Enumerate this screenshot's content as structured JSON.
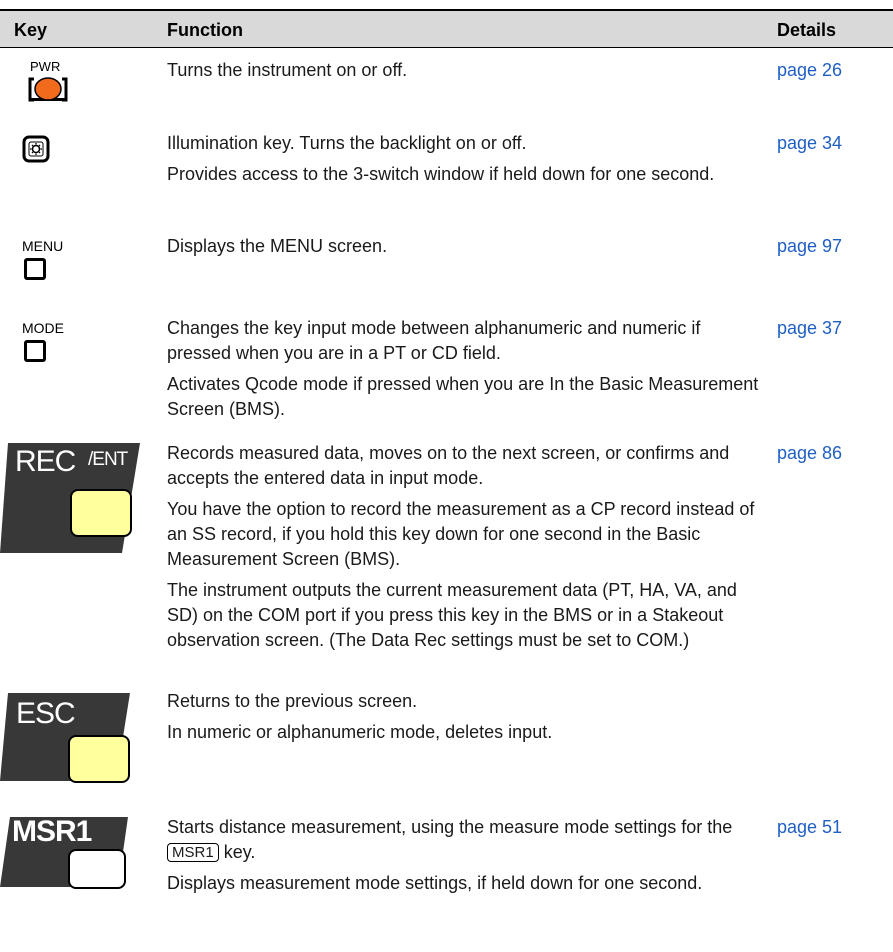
{
  "header": {
    "key": "Key",
    "function": "Function",
    "details": "Details"
  },
  "rows": [
    {
      "key_label": "PWR",
      "icon": "power-key-icon",
      "lines": [
        "Turns the instrument on or off."
      ],
      "details": "page 26"
    },
    {
      "key_label": "",
      "icon": "illumination-key-icon",
      "lines": [
        "Illumination key. Turns the backlight on or off.",
        "Provides access to the 3-switch window if held down for one second."
      ],
      "details": "page 34"
    },
    {
      "key_label": "MENU",
      "icon": "menu-key-icon",
      "lines": [
        "Displays the MENU screen."
      ],
      "details": "page 97"
    },
    {
      "key_label": "MODE",
      "icon": "mode-key-icon",
      "lines": [
        "Changes the key input mode between alphanumeric and numeric if pressed when you are in a PT or CD field.",
        "Activates Qcode mode if pressed when you are In the Basic Measurement Screen (BMS)."
      ],
      "details": "page 37"
    },
    {
      "key_label": "REC/ENT",
      "key_label_main": "REC",
      "key_label_sub": "/ENT",
      "icon": "rec-ent-key-icon",
      "lines": [
        "Records measured data, moves on to the next screen, or confirms and accepts the entered data in input mode.",
        "You have the option to record the measurement as a CP record instead of an SS record, if you hold this key down for one second in the Basic Measurement Screen (BMS).",
        "The instrument outputs the current measurement data (PT, HA, VA, and SD) on the COM port if you press this key in the BMS or in a Stakeout observation screen. (The Data Rec settings must be set to COM.)"
      ],
      "details": "page 86"
    },
    {
      "key_label": "ESC",
      "icon": "esc-key-icon",
      "lines": [
        "Returns to the previous screen.",
        "In numeric or alphanumeric mode, deletes input."
      ],
      "details": ""
    },
    {
      "key_label": "MSR1",
      "icon": "msr1-key-icon",
      "lines_pre": "Starts distance measurement, using the measure mode settings for the ",
      "inline_key": "MSR1",
      "lines_post": " key.",
      "line2": "Displays measurement mode settings, if held down for one second.",
      "details": "page 51"
    }
  ],
  "colors": {
    "header_bg": "#d9d9d9",
    "link": "#1f5fc4",
    "power_orange": "#f26a1b",
    "key_yellow": "#ffff9e",
    "key_dark": "#383838"
  }
}
